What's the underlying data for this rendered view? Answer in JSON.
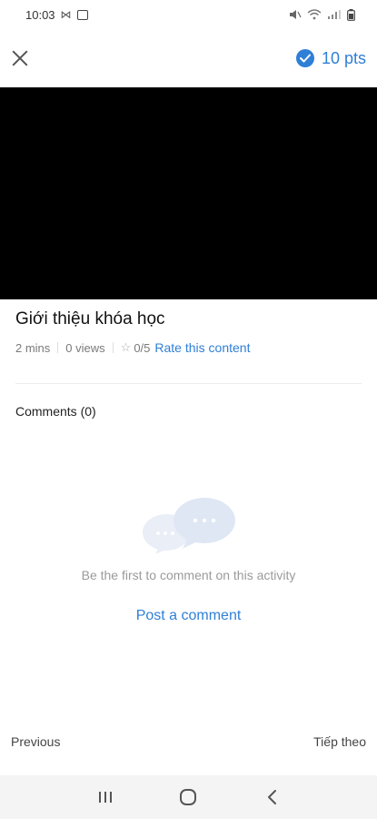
{
  "status_bar": {
    "time": "10:03"
  },
  "header": {
    "points_label": "10 pts"
  },
  "content": {
    "title": "Giới thiệu khóa học",
    "duration": "2 mins",
    "views": "0 views",
    "rating": "0/5",
    "rate_label": "Rate this content"
  },
  "comments": {
    "header": "Comments (0)",
    "empty_text": "Be the first to comment on this activity",
    "post_label": "Post a comment"
  },
  "navigation": {
    "previous_label": "Previous",
    "next_label": "Tiếp theo"
  },
  "colors": {
    "accent": "#2f7fd6",
    "video_background": "#000000",
    "system_nav_background": "#f4f4f4"
  }
}
